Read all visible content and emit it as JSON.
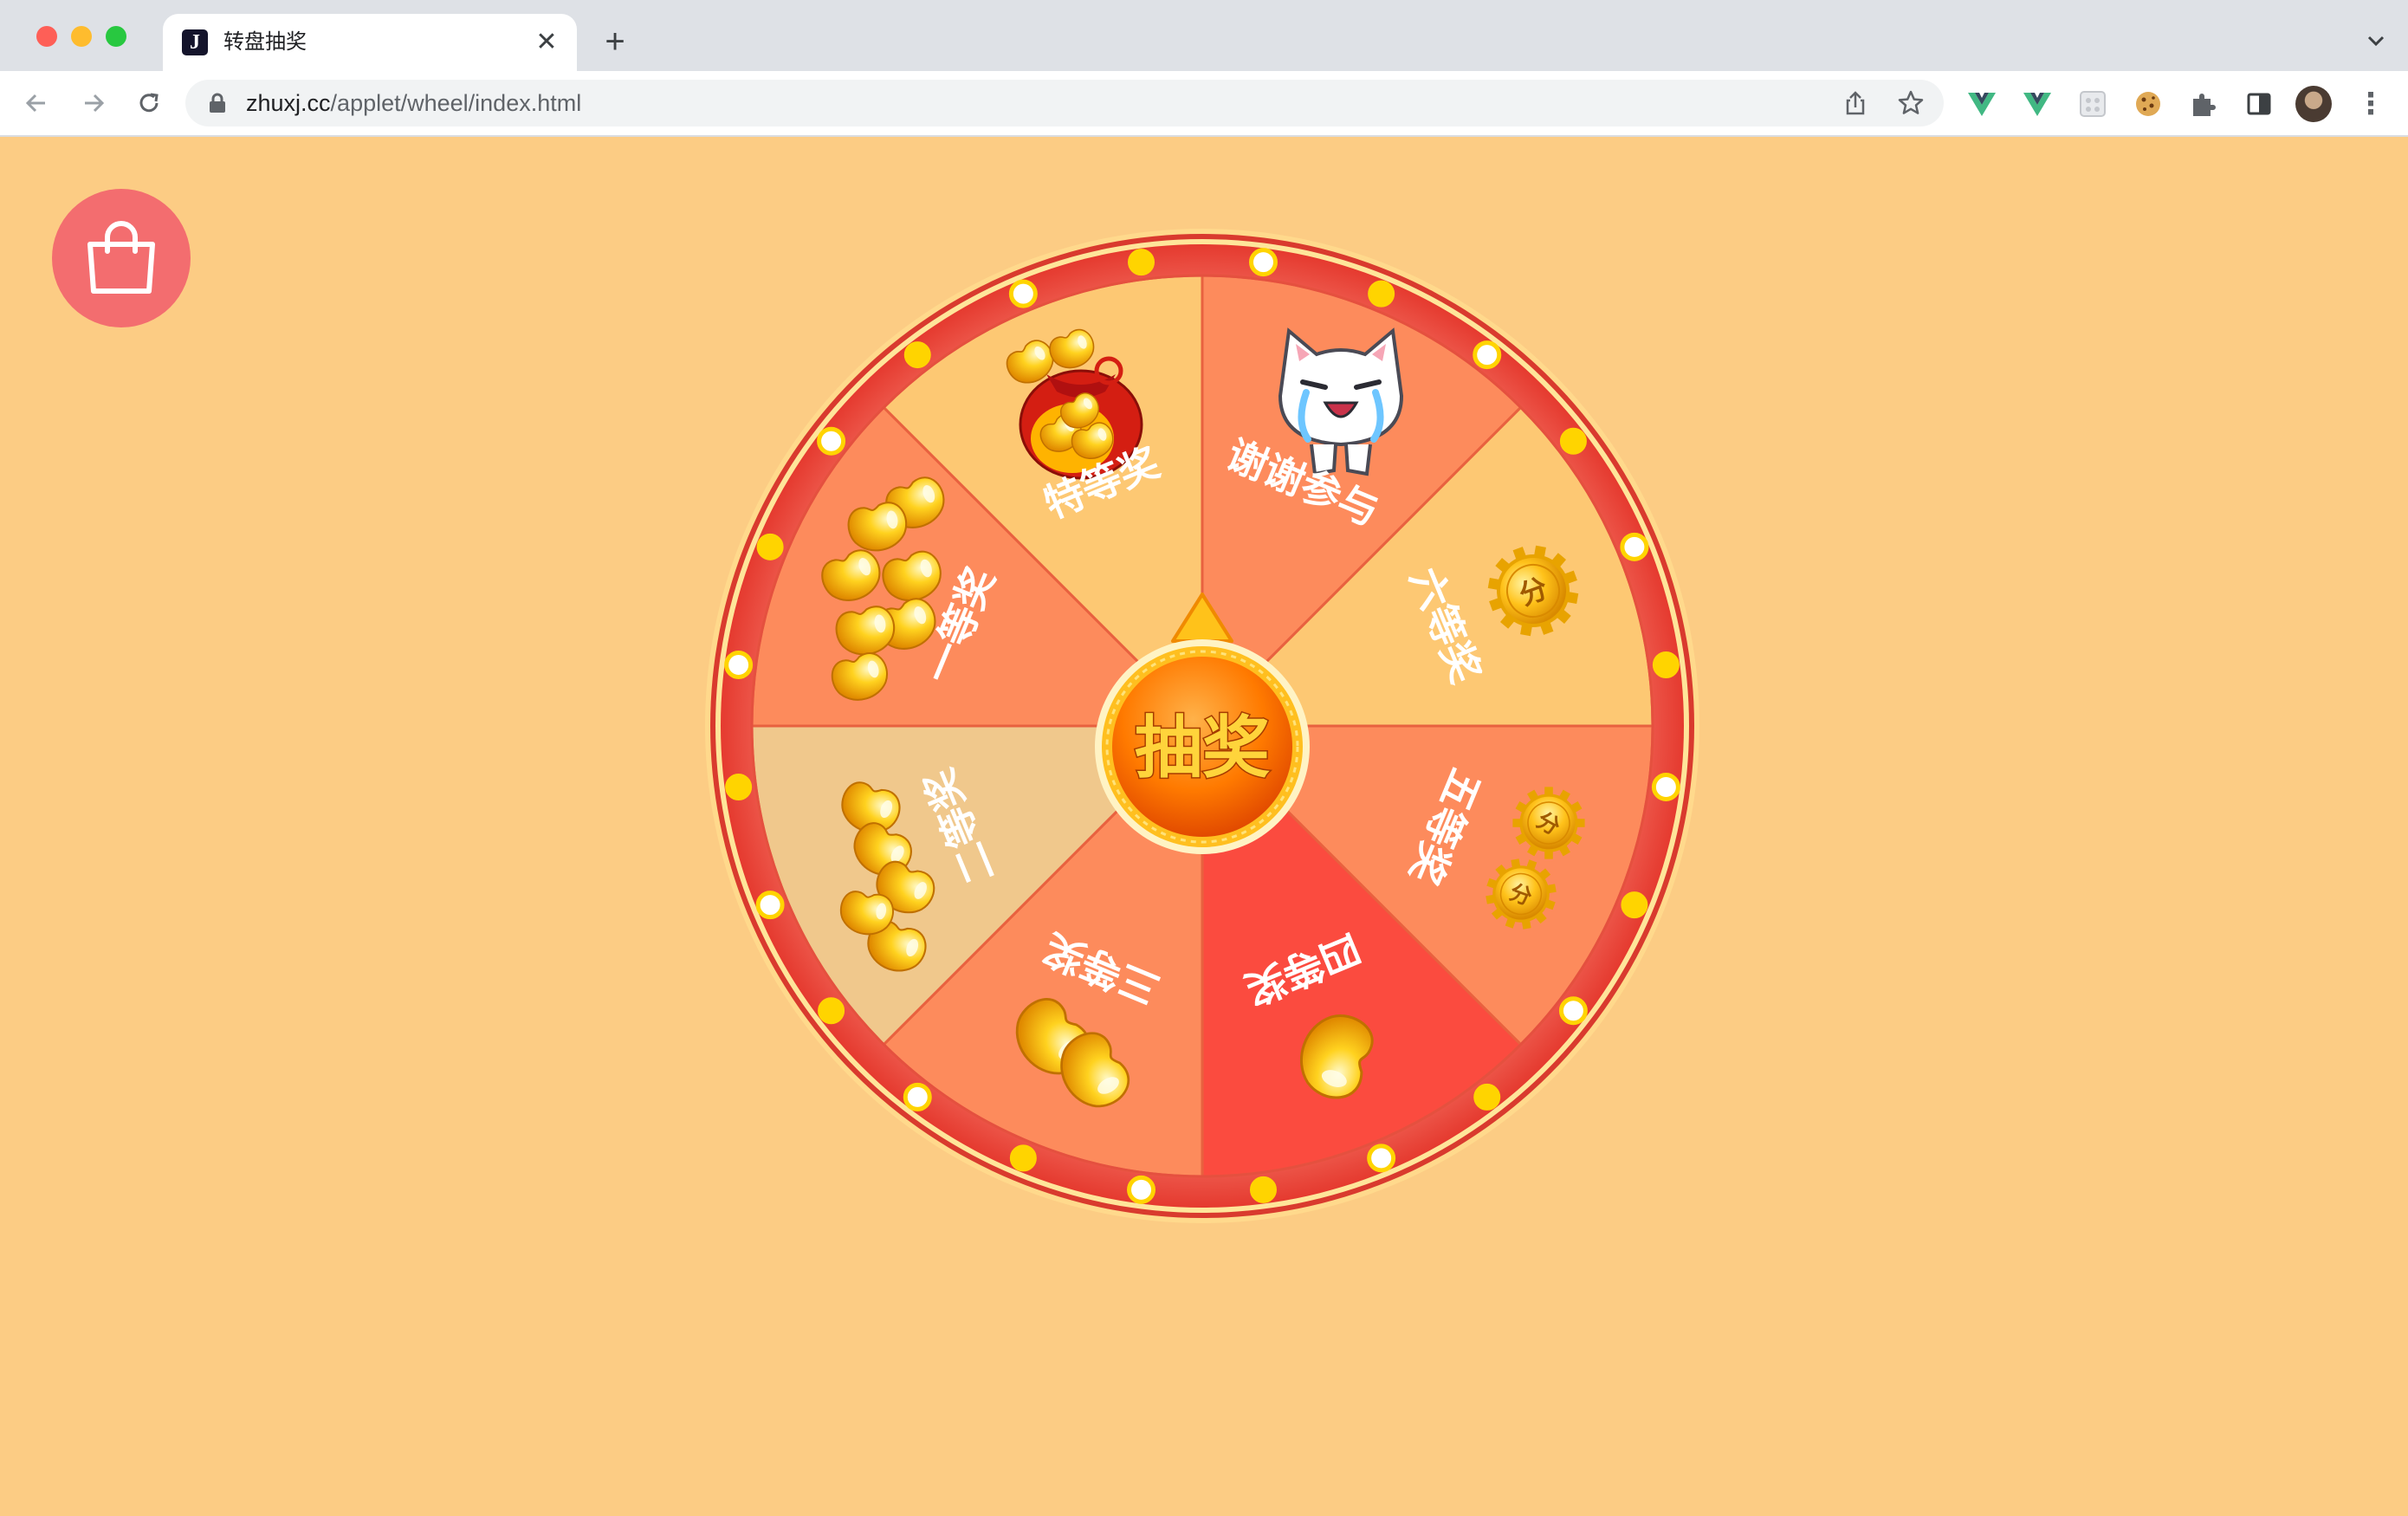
{
  "browser": {
    "tab": {
      "title": "转盘抽奖",
      "favicon_letter": "J"
    },
    "url": {
      "host": "zhuxj.cc",
      "path": "/applet/wheel/index.html"
    },
    "icons": [
      "back-icon",
      "forward-icon",
      "reload-icon",
      "lock-icon",
      "share-icon",
      "bookmark-star-icon",
      "vue-devtools-icon",
      "vue-devtools-icon",
      "extension-icon",
      "cookie-icon",
      "puzzle-icon",
      "side-panel-icon",
      "profile-avatar",
      "more-menu-icon"
    ]
  },
  "page": {
    "cart_icon": "shopping-bag-icon",
    "colors": {
      "background": "#fccc84",
      "cart_button": "#f36d6f",
      "wheel_rim": "#ef5a4f",
      "start_button": "#ff7a00"
    },
    "wheel": {
      "start_label": "抽奖",
      "segments": [
        {
          "label": "谢谢参与",
          "color": "#fd8b5c",
          "icon": "crying-cat-icon"
        },
        {
          "label": "六等奖",
          "color": "#fdc873",
          "icon": "single-coin-icon"
        },
        {
          "label": "五等奖",
          "color": "#fd8b5c",
          "icon": "two-coins-icon"
        },
        {
          "label": "四等奖",
          "color": "#fb4b3f",
          "icon": "single-gold-bean-icon"
        },
        {
          "label": "三等奖",
          "color": "#fd8b5c",
          "icon": "two-gold-beans-icon"
        },
        {
          "label": "二等奖",
          "color": "#f0c88c",
          "icon": "gold-bean-cluster-icon"
        },
        {
          "label": "一等奖",
          "color": "#fd8b5c",
          "icon": "large-gold-bean-cluster-icon"
        },
        {
          "label": "特等奖",
          "color": "#fdc873",
          "icon": "gold-bean-bag-icon"
        }
      ]
    }
  }
}
